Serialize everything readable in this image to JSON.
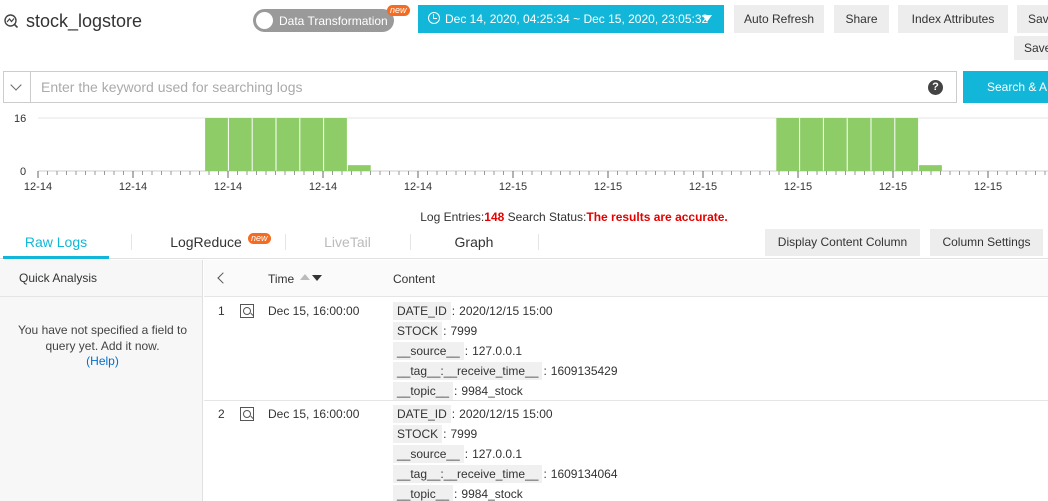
{
  "header": {
    "title": "stock_logstore",
    "toggle_label": "Data Transformation",
    "new_badge": "new",
    "time_range": "Dec 14, 2020, 04:25:34 ~ Dec 15, 2020, 23:05:32",
    "buttons": [
      "Auto Refresh",
      "Share",
      "Index Attributes",
      "Sav"
    ],
    "save_row2": "Save"
  },
  "search": {
    "placeholder": "Enter the keyword used for searching logs",
    "help": "?",
    "button_label": "Search & A"
  },
  "histogram": {
    "y_top_label": "16",
    "y_zero_label": "0",
    "x_tick_labels": [
      "12-14",
      "12-14",
      "12-14",
      "12-14",
      "12-14",
      "12-15",
      "12-15",
      "12-15",
      "12-15",
      "12-15",
      "12-15"
    ],
    "bar_color": "#8ecc67",
    "bars_fraction_of_max": [
      0,
      0,
      0,
      0,
      0,
      0,
      0,
      1,
      1,
      1,
      1,
      1,
      1,
      0.15,
      0,
      0,
      0,
      0,
      0,
      0,
      0,
      0,
      0,
      0,
      0,
      0,
      0,
      0,
      0,
      0,
      0,
      1,
      1,
      1,
      1,
      1,
      1,
      0.15,
      0,
      0,
      0,
      0,
      0
    ]
  },
  "status": {
    "entries_label": "Log Entries:",
    "entries_count": "148",
    "search_status_label": "Search Status:",
    "search_status_value": "The results are accurate."
  },
  "tabs": {
    "raw_logs": "Raw Logs",
    "logreduce": "LogReduce",
    "logreduce_badge": "new",
    "livetail": "LiveTail",
    "graph": "Graph",
    "display_content_column": "Display Content Column",
    "column_settings": "Column Settings"
  },
  "left_panel": {
    "heading": "Quick Analysis",
    "message": "You have not specified a field to query yet. Add it now.",
    "help_link": "(Help)"
  },
  "table": {
    "col_time": "Time",
    "col_content": "Content",
    "rows": [
      {
        "index": "1",
        "time": "Dec 15, 16:00:00",
        "fields": [
          {
            "k": "DATE_ID",
            "v": "2020/12/15 15:00"
          },
          {
            "k": "STOCK",
            "v": "7999"
          },
          {
            "k": "__source__",
            "v": "127.0.0.1"
          },
          {
            "k": "__tag__:__receive_time__",
            "v": "1609135429"
          },
          {
            "k": "__topic__",
            "v": "9984_stock"
          }
        ]
      },
      {
        "index": "2",
        "time": "Dec 15, 16:00:00",
        "fields": [
          {
            "k": "DATE_ID",
            "v": "2020/12/15 15:00"
          },
          {
            "k": "STOCK",
            "v": "7999"
          },
          {
            "k": "__source__",
            "v": "127.0.0.1"
          },
          {
            "k": "__tag__:__receive_time__",
            "v": "1609134064"
          },
          {
            "k": "__topic__",
            "v": "9984_stock"
          }
        ]
      }
    ]
  }
}
